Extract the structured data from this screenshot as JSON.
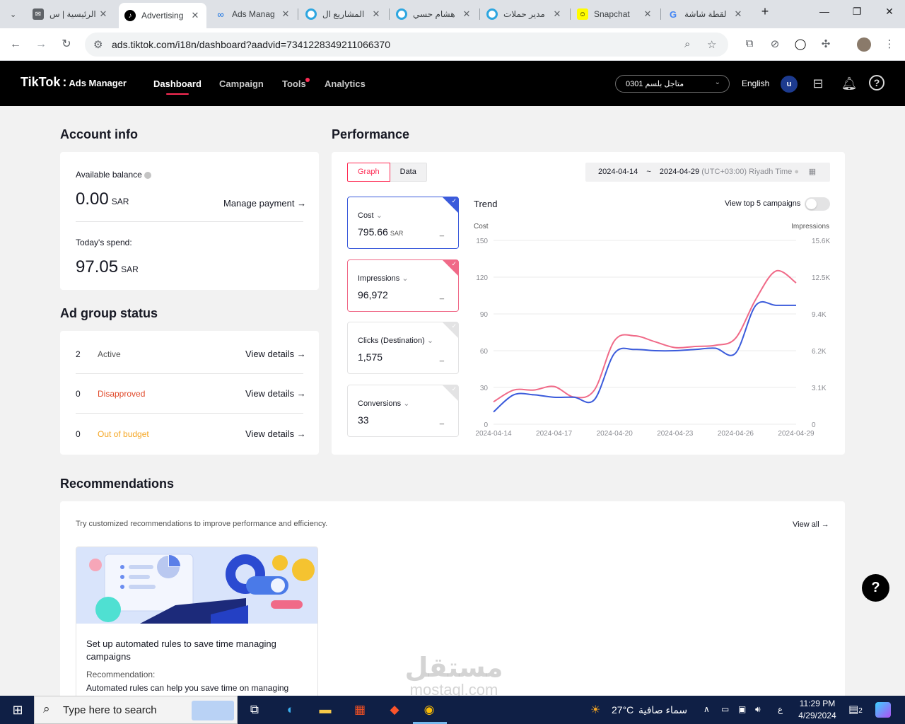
{
  "browser": {
    "tabs": [
      {
        "title": "الرئيسية | س",
        "favicon": "mail-icon"
      },
      {
        "title": "Advertising",
        "favicon": "tiktok-icon",
        "active": true
      },
      {
        "title": "Ads Manag",
        "favicon": "meta-icon"
      },
      {
        "title": "المشاريع ال",
        "favicon": "circle-icon"
      },
      {
        "title": "هشام حسي",
        "favicon": "circle-icon"
      },
      {
        "title": "مدير حملات",
        "favicon": "circle-icon"
      },
      {
        "title": "Snapchat",
        "favicon": "snapchat-icon"
      },
      {
        "title": "لقطة شاشة",
        "favicon": "google-icon"
      }
    ],
    "url": "ads.tiktok.com/i18n/dashboard?aadvid=7341228349211066370"
  },
  "header": {
    "logo": "TikTok",
    "logo_sub": "Ads Manager",
    "nav": [
      "Dashboard",
      "Campaign",
      "Tools",
      "Analytics"
    ],
    "account": "0301 متاجل بلسم",
    "language": "English",
    "avatar_letter": "u"
  },
  "account_info": {
    "title": "Account info",
    "balance_label": "Available balance",
    "balance_value": "0.00",
    "currency": "SAR",
    "manage_payment": "Manage payment →",
    "spend_label": "Today's spend:",
    "spend_value": "97.05"
  },
  "ad_group_status": {
    "title": "Ad group status",
    "rows": [
      {
        "count": "2",
        "label": "Active",
        "link": "View details →",
        "color": "#545454"
      },
      {
        "count": "0",
        "label": "Disapproved",
        "link": "View details →",
        "color": "#e0492a"
      },
      {
        "count": "0",
        "label": "Out of budget",
        "link": "View details →",
        "color": "#f5a623"
      }
    ]
  },
  "performance": {
    "title": "Performance",
    "tab_graph": "Graph",
    "tab_data": "Data",
    "date_start": "2024-04-14",
    "date_sep": "~",
    "date_end": "2024-04-29",
    "timezone": "(UTC+03:00) Riyadh Time",
    "metrics": [
      {
        "label": "Cost",
        "value": "795.66",
        "unit": "SAR"
      },
      {
        "label": "Impressions",
        "value": "96,972",
        "unit": ""
      },
      {
        "label": "Clicks (Destination)",
        "value": "1,575",
        "unit": ""
      },
      {
        "label": "Conversions",
        "value": "33",
        "unit": ""
      }
    ],
    "metric_dash": "_",
    "trend_title": "Trend",
    "top5_label": "View top 5 campaigns",
    "left_axis_label": "Cost",
    "right_axis_label": "Impressions"
  },
  "chart_data": {
    "type": "line",
    "title": "Trend",
    "x": [
      "2024-04-14",
      "2024-04-15",
      "2024-04-16",
      "2024-04-17",
      "2024-04-18",
      "2024-04-19",
      "2024-04-20",
      "2024-04-21",
      "2024-04-22",
      "2024-04-23",
      "2024-04-24",
      "2024-04-25",
      "2024-04-26",
      "2024-04-27",
      "2024-04-28",
      "2024-04-29"
    ],
    "x_ticks": [
      "2024-04-14",
      "2024-04-17",
      "2024-04-20",
      "2024-04-23",
      "2024-04-26",
      "2024-04-29"
    ],
    "left_ticks": [
      "150",
      "120",
      "90",
      "60",
      "30",
      "0"
    ],
    "right_ticks": [
      "15.6K",
      "12.5K",
      "9.4K",
      "6.2K",
      "3.1K",
      "0"
    ],
    "ylim_left": [
      0,
      150
    ],
    "ylim_right": [
      0,
      15600
    ],
    "grid": true,
    "series": [
      {
        "name": "Cost",
        "axis": "left",
        "color": "#3b5bdb",
        "values": [
          10,
          24,
          24,
          22,
          22,
          20,
          58,
          61,
          60,
          60,
          61,
          62,
          58,
          97,
          97,
          97
        ]
      },
      {
        "name": "Impressions",
        "axis": "right",
        "color": "#f06a88",
        "values": [
          1900,
          2900,
          2900,
          3200,
          2300,
          2900,
          7100,
          7500,
          7000,
          6500,
          6600,
          6700,
          7300,
          10600,
          13000,
          12000
        ]
      }
    ]
  },
  "recommendations": {
    "title": "Recommendations",
    "intro": "Try customized recommendations to improve performance and efficiency.",
    "view_all": "View all →",
    "card_title": "Set up automated rules to save time managing campaigns",
    "card_label": "Recommendation:",
    "card_text": "Automated rules can help you save time on managing"
  },
  "taskbar": {
    "search_placeholder": "Type here to search",
    "weather_temp": "27°C",
    "weather_text": "سماء صافية",
    "time": "11:29 PM",
    "date": "4/29/2024",
    "input_lang": "ع",
    "notifications": "2"
  },
  "watermark": {
    "line1": "مستقل",
    "line2": "mostaql.com"
  }
}
